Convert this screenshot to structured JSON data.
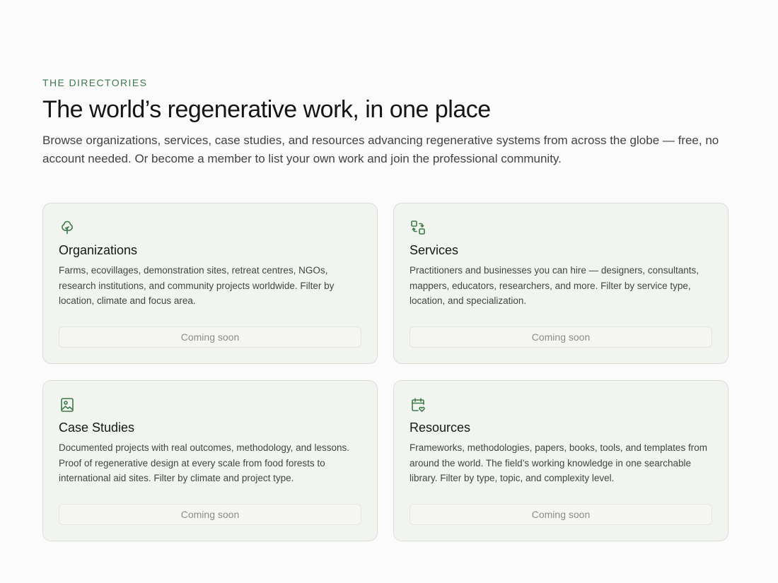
{
  "header": {
    "eyebrow": "THE DIRECTORIES",
    "title": "The world’s regenerative work, in one place",
    "lede": "Browse organizations, services, case studies, and resources advancing regenerative systems from across the globe — free, no account needed. Or become a member to list your own work and join the professional community."
  },
  "colors": {
    "accent": "#3d7a4a",
    "card_bg": "#f2f4ef",
    "card_border": "#d9ded6"
  },
  "cards": [
    {
      "icon": "tree-icon",
      "title": "Organizations",
      "description": "Farms, ecovillages, demonstration sites, retreat centres, NGOs, research institutions, and community projects worldwide. Filter by location, climate and focus area.",
      "button_label": "Coming soon"
    },
    {
      "icon": "connection-icon",
      "title": "Services",
      "description": "Practitioners and businesses you can hire — designers, consultants, mappers, educators, researchers, and more. Filter by service type, location, and specialization.",
      "button_label": "Coming soon"
    },
    {
      "icon": "image-icon",
      "title": "Case Studies",
      "description": "Documented projects with real outcomes, methodology, and lessons. Proof of regenerative design at every scale from food forests to international aid sites. Filter by climate and project type.",
      "button_label": "Coming soon"
    },
    {
      "icon": "calendar-heart-icon",
      "title": "Resources",
      "description": "Frameworks, methodologies, papers, books, tools, and templates from around the world. The field’s working knowledge in one searchable library. Filter by type, topic, and complexity level.",
      "button_label": "Coming soon"
    }
  ]
}
